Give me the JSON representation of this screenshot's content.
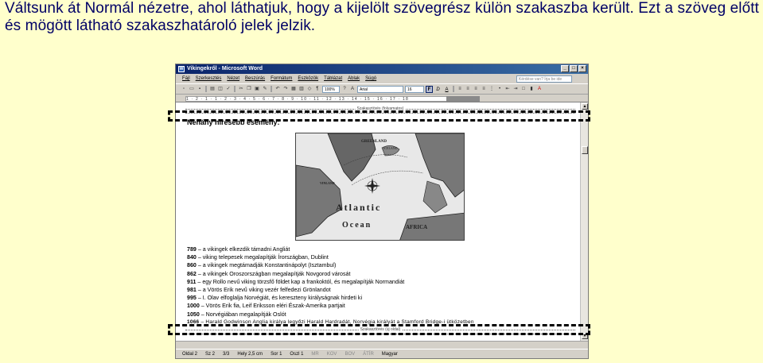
{
  "caption": "Váltsunk át Normál nézetre, ahol láthatjuk, hogy a kijelölt szövegrész külön szakaszba került. Ezt a szö­veg előtt és mögött látható szakaszhatároló jelek jelzik.",
  "window": {
    "title": "Vikingekről - Microsoft Word",
    "menus": [
      "Fájl",
      "Szerkesztés",
      "Nézet",
      "Beszúrás",
      "Formátum",
      "Eszközök",
      "Táblázat",
      "Ablak",
      "Súgó"
    ],
    "help_placeholder": "Kérdése van? Írja be ide",
    "zoom": "100%",
    "font": "Arial",
    "font_size": "16",
    "format_buttons": [
      "F",
      "D",
      "A"
    ]
  },
  "ruler": "1 · 2 · 1 · 1 · 2 · 3 · 4 · 5 · 6 · 7 · 8 · 9 · 10 · 11 · 12 · 13 · 14 · 15 · 16 · 17 · 18",
  "section_break_top": "Szakasztörés (folyamatos)",
  "section_break_bottom": "Szakasztörés (új oldal)",
  "heading": "Néhány híresebb esemény:",
  "map_labels": {
    "greenland": "GREENLAND",
    "iceland": "ICELAND",
    "vinland": "VINLAND",
    "atlantic": "Atlantic",
    "ocean": "Ocean",
    "africa": "AFRICA"
  },
  "events": [
    {
      "year": "789",
      "text": " – a vikingek elkezdik támadni Angliát"
    },
    {
      "year": "840",
      "text": " – viking telepesek megalapítják Írországban, Dublint"
    },
    {
      "year": "860",
      "text": " – a vikingek megtámadják Konstantinápolyt (Isztambul)"
    },
    {
      "year": "862",
      "text": " – a vikingek Oroszországban megalapítják Novgorod városát"
    },
    {
      "year": "911",
      "text": " – egy Rollo nevű viking törzsfő földet kap a frankoktól, és megalapítják Normandiát"
    },
    {
      "year": "981",
      "text": " – a Vörös Erik nevű viking vezér felfedezi Grönlandot"
    },
    {
      "year": "995",
      "text": " – I. Olav elfoglalja Norvégiát, és kereszteny királyságnak hirdeti ki"
    },
    {
      "year": "1000",
      "text": " – Vörös Erik fia, Leif Eriksson eléri Észak-Amerika partjait"
    },
    {
      "year": "1050",
      "text": " – Norvégiában megalapítják Oslót"
    },
    {
      "year": "1066",
      "text": " – Harald Godwinson Anglia királya legyőzi Harald Hardradát, Norvégia királyát a Stamford Bridge-i ütközetben"
    }
  ],
  "status": {
    "page": "Oldal 2",
    "section": "Sz 2",
    "pages": "3/3",
    "position": "Hely 2,5 cm",
    "line": "Sor 1",
    "col": "Oszl 1",
    "rec": "MR",
    "rev": "KOV",
    "ext": "BOV",
    "ovr": "ÁTÍR",
    "lang": "Magyar"
  }
}
